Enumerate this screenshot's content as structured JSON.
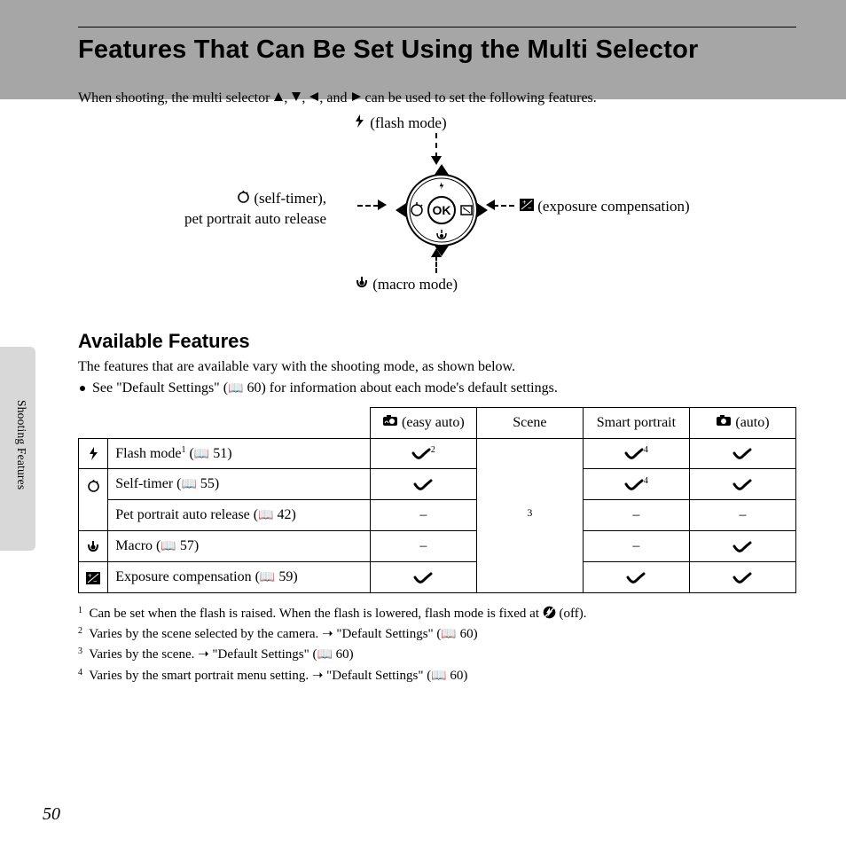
{
  "page_number": "50",
  "side_tab": "Shooting Features",
  "title": "Features That Can Be Set Using the Multi Selector",
  "intro_prefix": "When shooting, the multi selector ",
  "intro_suffix": " can be used to set the following features.",
  "diagram": {
    "up": "(flash mode)",
    "down": "(macro mode)",
    "right": "(exposure compensation)",
    "left_line1": "(self-timer),",
    "left_line2": "pet portrait auto release",
    "ok": "OK"
  },
  "section2": {
    "title": "Available Features",
    "para": "The features that are available vary with the shooting mode, as shown below.",
    "bullet_prefix": "See \"Default Settings\" (",
    "bullet_pageref": "60",
    "bullet_suffix": ") for information about each mode's default settings."
  },
  "table": {
    "headers": {
      "easy_auto": "(easy auto)",
      "scene": "Scene",
      "smart_portrait": "Smart portrait",
      "auto": "(auto)"
    },
    "rows": {
      "flash": {
        "name_prefix": "Flash mode",
        "sup": "1",
        "ref": "51"
      },
      "selftimer": {
        "name": "Self-timer",
        "ref": "55"
      },
      "pet": {
        "name": "Pet portrait auto release",
        "ref": "42"
      },
      "macro": {
        "name": "Macro",
        "ref": "57"
      },
      "exp": {
        "name": "Exposure compensation",
        "ref": "59"
      }
    },
    "scene_note_sup": "3"
  },
  "footnotes": {
    "n1_prefix": "Can be set when the flash is raised. When the flash is lowered, flash mode is fixed at ",
    "n1_suffix": " (off).",
    "n2": "Varies by the scene selected by the camera. ➝ \"Default Settings\" (",
    "n2_ref": "60",
    "n3": "Varies by the scene. ➝ \"Default Settings\" (",
    "n3_ref": "60",
    "n4": "Varies by the smart portrait menu setting. ➝ \"Default Settings\" (",
    "n4_ref": "60"
  }
}
